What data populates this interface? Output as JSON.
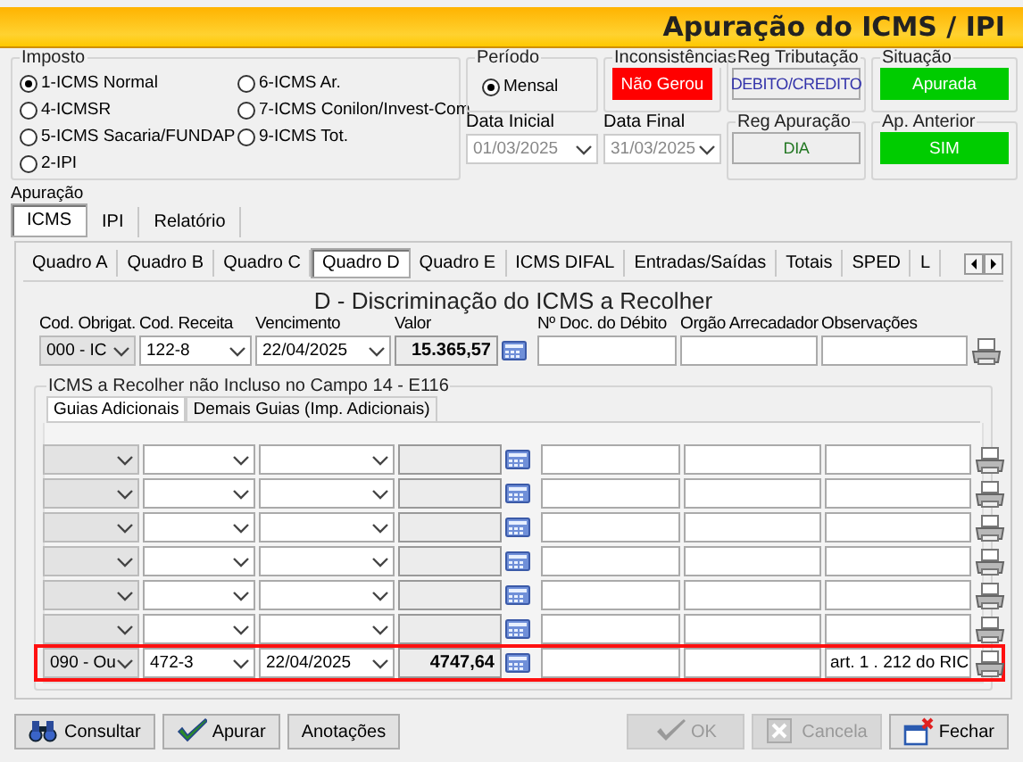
{
  "window": {
    "title": "Apuração do ICMS / IPI"
  },
  "imposto": {
    "label": "Imposto",
    "options": [
      {
        "label": "1-ICMS Normal",
        "selected": true
      },
      {
        "label": "4-ICMSR",
        "selected": false
      },
      {
        "label": "5-ICMS Sacaria/FUNDAP",
        "selected": false
      },
      {
        "label": "2-IPI",
        "selected": false
      },
      {
        "label": "6-ICMS Ar.",
        "selected": false
      },
      {
        "label": "7-ICMS Conilon/Invest-Com",
        "selected": false
      },
      {
        "label": "9-ICMS Tot.",
        "selected": false
      }
    ]
  },
  "periodo": {
    "label": "Período",
    "options": [
      {
        "label": "Mensal",
        "selected": true
      }
    ]
  },
  "indicators": [
    {
      "label": "Inconsistências",
      "value": "Não Gerou",
      "kind": "flag",
      "color": "#ff0000"
    },
    {
      "label": "Reg Tributação",
      "value": "DEBITO/CREDITO",
      "kind": "readout",
      "color": "#3333aa"
    },
    {
      "label": "Situação",
      "value": "Apurada",
      "kind": "flag",
      "color": "#00cc00"
    },
    {
      "label": "Reg Apuração",
      "value": "DIA",
      "kind": "readout",
      "color": "#227722"
    },
    {
      "label": "Ap. Anterior",
      "value": "SIM",
      "kind": "flag",
      "color": "#00cc00"
    }
  ],
  "dates": [
    {
      "label": "Data Inicial",
      "value": "01/03/2025",
      "disabled": true
    },
    {
      "label": "Data Final",
      "value": "31/03/2025",
      "disabled": true
    }
  ],
  "apuracao": {
    "label": "Apuração",
    "tabs": [
      {
        "label": "ICMS",
        "selected": true
      },
      {
        "label": "IPI",
        "selected": false
      },
      {
        "label": "Relatório",
        "selected": false
      }
    ]
  },
  "quadro_tabs": [
    {
      "label": "Quadro A",
      "selected": false
    },
    {
      "label": "Quadro B",
      "selected": false
    },
    {
      "label": "Quadro C",
      "selected": false
    },
    {
      "label": "Quadro D",
      "selected": true
    },
    {
      "label": "Quadro E",
      "selected": false
    },
    {
      "label": "ICMS DIFAL",
      "selected": false
    },
    {
      "label": "Entradas/Saídas",
      "selected": false
    },
    {
      "label": "Totais",
      "selected": false
    },
    {
      "label": "SPED",
      "selected": false
    },
    {
      "label": "L",
      "selected": false
    }
  ],
  "section_title": "D - Discriminação do ICMS a Recolher",
  "columns": [
    "Cod. Obrigat.",
    "Cod. Receita",
    "Vencimento",
    "Valor",
    "Nº Doc. do Débito",
    "Orgão Arrecadador",
    "Observações"
  ],
  "main_row": {
    "cod_obrigat": "000 - IC",
    "cod_receita": "122-8",
    "vencimento": "22/04/2025",
    "valor": "15.365,57"
  },
  "guias": {
    "label": "ICMS a Recolher não Incluso no Campo 14 - E116",
    "tabs": [
      {
        "label": "Guias Adicionais",
        "selected": true
      },
      {
        "label": "Demais Guias (Imp. Adicionais)",
        "selected": false
      }
    ],
    "rows": [
      {
        "highlighted": false
      },
      {
        "highlighted": false
      },
      {
        "highlighted": false
      },
      {
        "highlighted": false
      },
      {
        "highlighted": false
      },
      {
        "highlighted": false
      },
      {
        "highlighted": true,
        "cod_obrigat": "090 - Ou",
        "cod_receita": "472-3",
        "vencimento": "22/04/2025",
        "valor": "4747,64",
        "observacoes": "art. 1 . 212 do RIC"
      }
    ]
  },
  "buttons": [
    {
      "label": "Consultar",
      "disabled": false
    },
    {
      "label": "Apurar",
      "disabled": false
    },
    {
      "label": "Anotações",
      "disabled": false
    },
    {
      "label": "OK",
      "disabled": true
    },
    {
      "label": "Cancela",
      "disabled": true
    },
    {
      "label": "Fechar",
      "disabled": false
    }
  ]
}
